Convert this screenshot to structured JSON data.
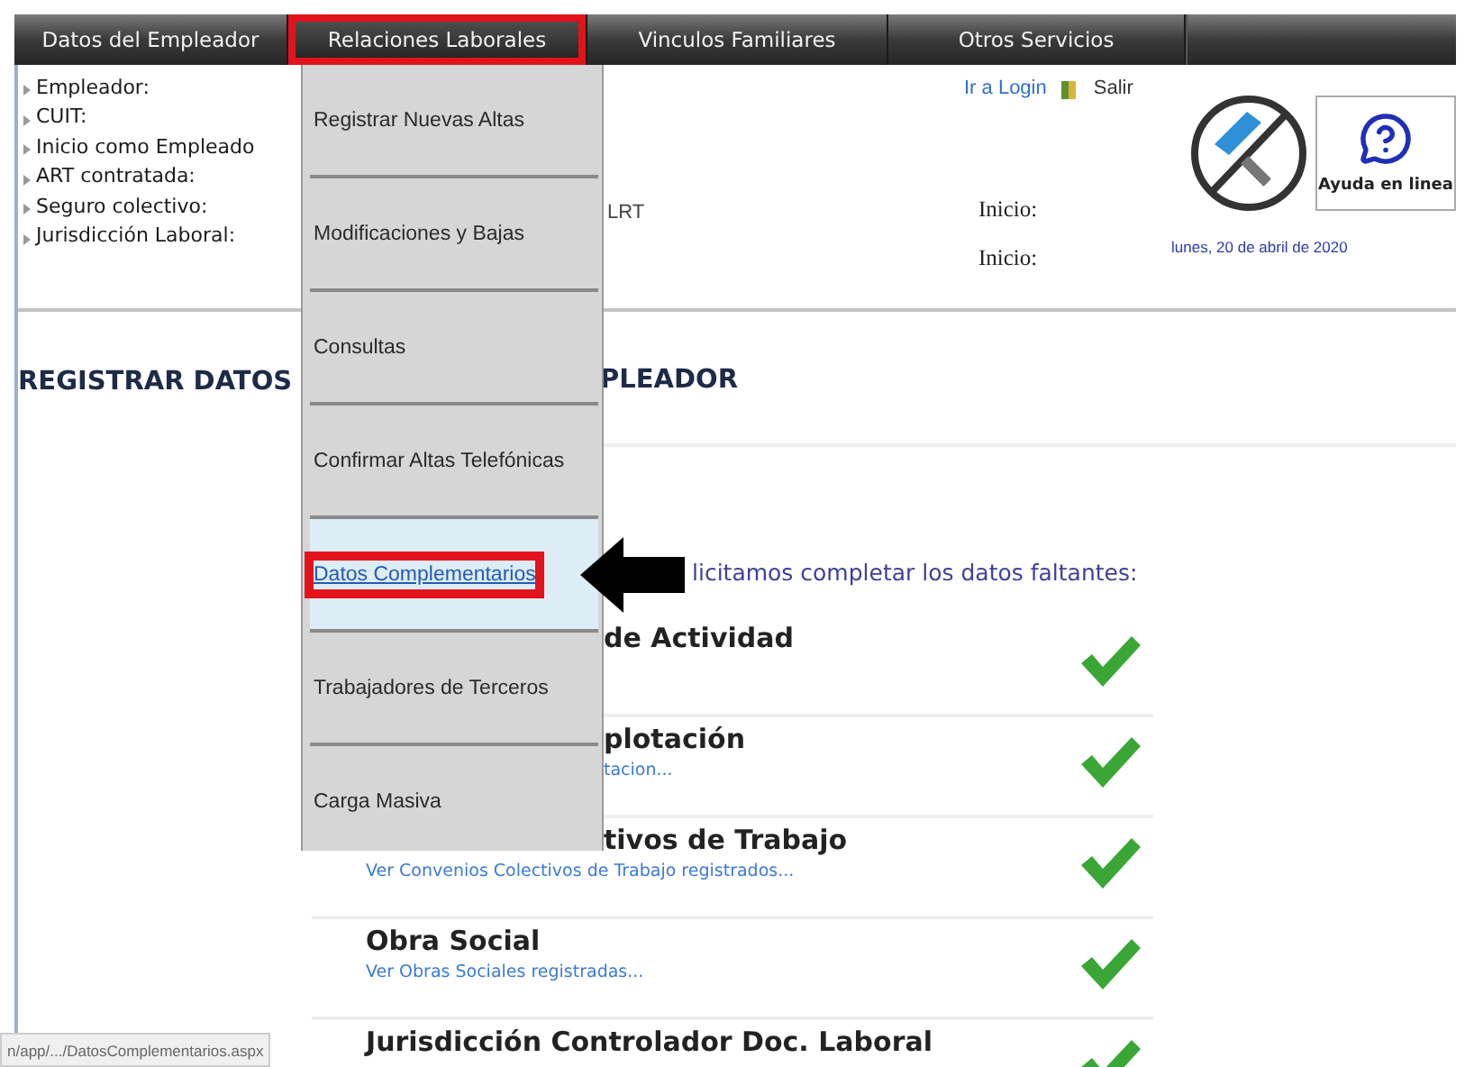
{
  "nav": [
    {
      "label": "Datos del Empleador",
      "selected": false,
      "highlighted": false
    },
    {
      "label": "Relaciones Laborales",
      "selected": true,
      "highlighted": true
    },
    {
      "label": "Vinculos Familiares",
      "selected": false,
      "highlighted": false
    },
    {
      "label": "Otros Servicios",
      "selected": false,
      "highlighted": false
    }
  ],
  "employer_fields": [
    "Empleador:",
    "CUIT:",
    "Inicio como Empleado",
    "ART contratada:",
    "Seguro colectivo:",
    "Jurisdicción Laboral:"
  ],
  "art_value": "LRT",
  "links": {
    "login": "Ir a Login",
    "logout": "Salir"
  },
  "start_labels": [
    "Inicio:",
    "Inicio:"
  ],
  "help_button": "Ayuda en linea",
  "date": "lunes, 20 de abril de 2020",
  "page_title": {
    "left": "REGISTRAR DATOS",
    "right": "PLEADOR"
  },
  "menu": {
    "items": [
      {
        "label": "Registrar Nuevas Altas",
        "selected": false,
        "highlighted": false
      },
      {
        "label": "Modificaciones y Bajas",
        "selected": false,
        "highlighted": false
      },
      {
        "label": "Consultas",
        "selected": false,
        "highlighted": false
      },
      {
        "label": "Confirmar Altas Telefónicas",
        "selected": false,
        "highlighted": false
      },
      {
        "label": "Datos Complementarios",
        "selected": true,
        "highlighted": true
      },
      {
        "label": "Trabajadores de Terceros",
        "selected": false,
        "highlighted": false
      },
      {
        "label": "Carga Masiva",
        "selected": false,
        "highlighted": false
      }
    ]
  },
  "intro": "licitamos completar los datos faltantes:",
  "sections": [
    {
      "title": "de Actividad",
      "completed": true
    },
    {
      "title": "plotación",
      "link": "tacion...",
      "completed": true
    },
    {
      "title": "tivos de Trabajo",
      "link": "Ver Convenios Colectivos de Trabajo registrados...",
      "completed": true
    },
    {
      "title": "Obra Social",
      "link": "Ver Obras Sociales registradas...",
      "completed": true
    },
    {
      "title": "Jurisdicción Controlador Doc. Laboral",
      "completed": true
    }
  ],
  "status_url": "n/app/.../DatosComplementarios.aspx"
}
